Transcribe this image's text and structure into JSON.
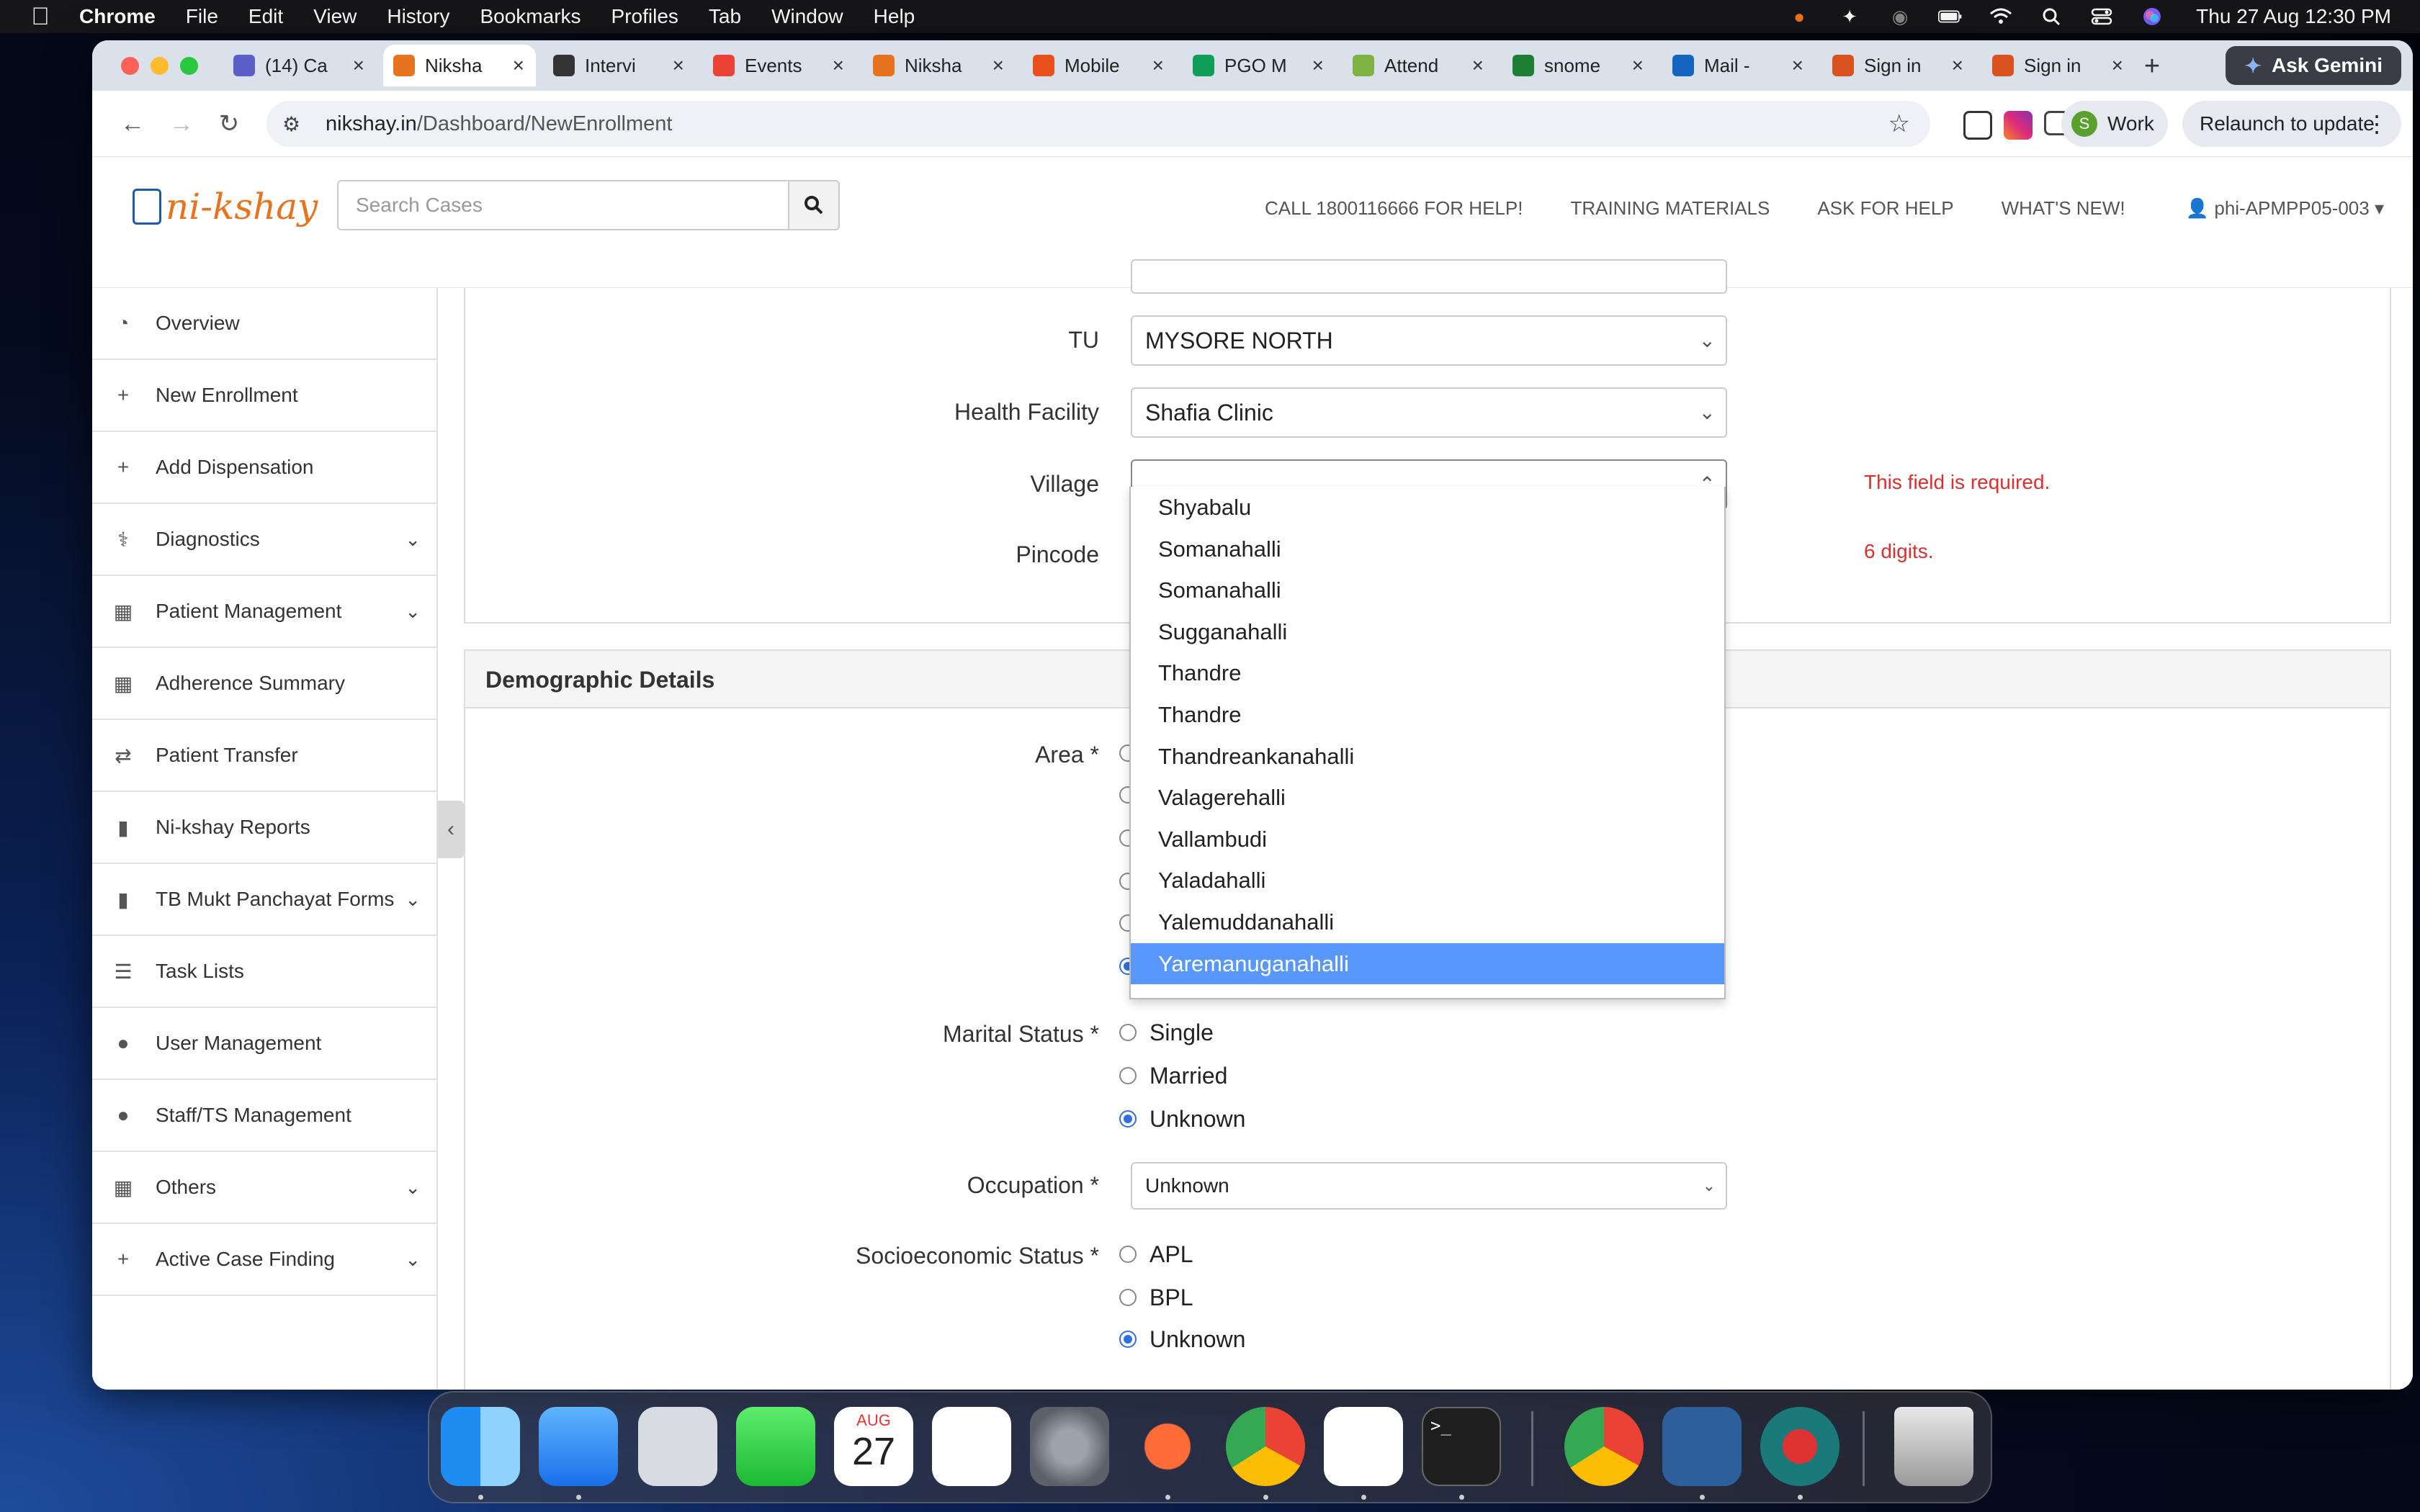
{
  "menubar": {
    "app": "Chrome",
    "items": [
      "File",
      "Edit",
      "View",
      "History",
      "Bookmarks",
      "Profiles",
      "Tab",
      "Window",
      "Help"
    ],
    "clock": "Thu 27 Aug  12:30 PM"
  },
  "browser": {
    "tabs": [
      {
        "title": "(14) Ca",
        "color": "#5b5fc7"
      },
      {
        "title": "Niksha",
        "color": "#e8731e",
        "active": true
      },
      {
        "title": "Intervi",
        "color": "#333333"
      },
      {
        "title": "Events",
        "color": "#ea4335"
      },
      {
        "title": "Niksha",
        "color": "#e8731e"
      },
      {
        "title": "Mobile",
        "color": "#e8501e"
      },
      {
        "title": "PGO M",
        "color": "#0f9d58"
      },
      {
        "title": "Attend",
        "color": "#7cb342"
      },
      {
        "title": "snome",
        "color": "#1e7e34"
      },
      {
        "title": "Mail - ",
        "color": "#1565c0"
      },
      {
        "title": "Sign in",
        "color": "#d9531e"
      },
      {
        "title": "Sign in",
        "color": "#d9531e"
      }
    ],
    "ask_gemini": "Ask Gemini",
    "url_host": "nikshay.in",
    "url_path": "/Dashboard/NewEnrollment",
    "profile_initial": "S",
    "profile_label": "Work",
    "relaunch_label": "Relaunch to update"
  },
  "header": {
    "logo_text": "ni-kshay",
    "search_placeholder": "Search Cases",
    "links": [
      "CALL 1800116666 FOR HELP!",
      "TRAINING MATERIALS",
      "ASK FOR HELP",
      "WHAT'S NEW!"
    ],
    "user": "phi-APMPP05-003"
  },
  "sidebar": {
    "items": [
      {
        "label": "Overview",
        "icon": "dashboard-icon"
      },
      {
        "label": "New Enrollment",
        "icon": "plus-icon"
      },
      {
        "label": "Add Dispensation",
        "icon": "plus-icon"
      },
      {
        "label": "Diagnostics",
        "icon": "stethoscope-icon",
        "expandable": true
      },
      {
        "label": "Patient Management",
        "icon": "medkit-icon",
        "expandable": true
      },
      {
        "label": "Adherence Summary",
        "icon": "calendar-icon"
      },
      {
        "label": "Patient Transfer",
        "icon": "exchange-icon"
      },
      {
        "label": "Ni-kshay Reports",
        "icon": "file-icon"
      },
      {
        "label": "TB Mukt Panchayat Forms",
        "icon": "file-icon",
        "expandable": true
      },
      {
        "label": "Task Lists",
        "icon": "list-icon"
      },
      {
        "label": "User Management",
        "icon": "user-icon"
      },
      {
        "label": "Staff/TS Management",
        "icon": "user-icon"
      },
      {
        "label": "Others",
        "icon": "medkit-icon",
        "expandable": true
      },
      {
        "label": "Active Case Finding",
        "icon": "plus-icon",
        "expandable": true
      }
    ]
  },
  "form": {
    "tu_label": "TU",
    "tu_value": "MYSORE NORTH",
    "facility_label": "Health Facility",
    "facility_value": "Shafia Clinic",
    "village_label": "Village",
    "village_error": "This field is required.",
    "pincode_label": "Pincode",
    "pincode_error": "6 digits.",
    "demographic_title": "Demographic Details",
    "area_label": "Area *",
    "marital_label": "Marital Status *",
    "marital_options": [
      "Single",
      "Married",
      "Unknown"
    ],
    "occupation_label": "Occupation *",
    "occupation_value": "Unknown",
    "socio_label": "Socioeconomic Status *",
    "socio_options": [
      "APL",
      "BPL",
      "Unknown"
    ]
  },
  "village_dropdown": {
    "options": [
      "Shyabalu",
      "Somanahalli",
      "Somanahalli",
      "Sugganahalli",
      "Thandre",
      "Thandre",
      "Thandreankanahalli",
      "Valagerehalli",
      "Vallambudi",
      "Yaladahalli",
      "Yalemuddanahalli",
      "Yaremanuganahalli"
    ],
    "highlighted": "Yaremanuganahalli"
  },
  "dock": {
    "calendar_month": "AUG",
    "calendar_day": "27"
  }
}
